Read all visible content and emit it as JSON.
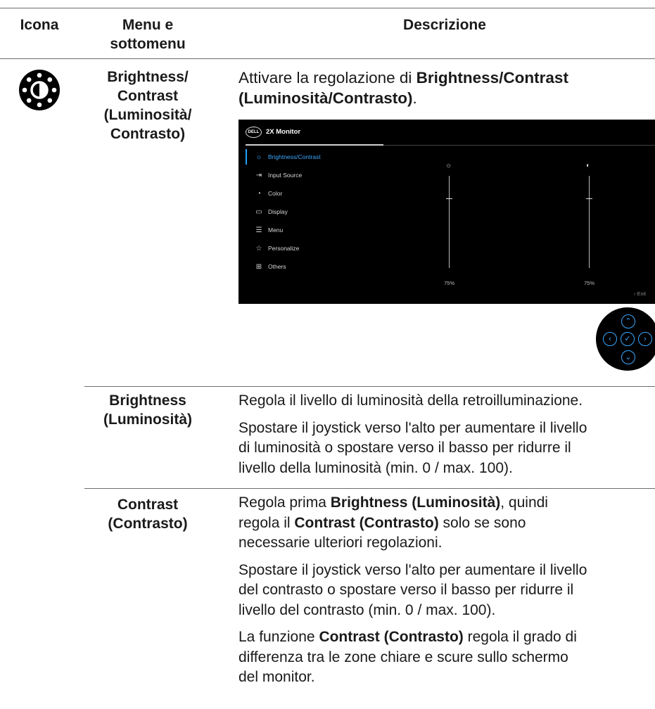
{
  "header": {
    "col_icon": "Icona",
    "col_menu_line1": "Menu e",
    "col_menu_line2": "sottomenu",
    "col_desc": "Descrizione"
  },
  "row_main": {
    "icon": "brightness-contrast-icon",
    "menu_lines": [
      "Brightness/",
      "Contrast",
      "(Luminosità/",
      "Contrasto)"
    ],
    "desc_pre": "Attivare la regolazione di ",
    "desc_bold": "Brightness/Contrast (Luminosità/Contrasto)",
    "desc_post": "."
  },
  "osd": {
    "logo": "DELL",
    "model": "2X Monitor",
    "menu_items": [
      {
        "label": "Brightness/Contrast",
        "icon": "sun-icon",
        "glyph": "☼",
        "selected": true
      },
      {
        "label": "Input Source",
        "icon": "input-icon",
        "glyph": "⇥",
        "selected": false
      },
      {
        "label": "Color",
        "icon": "color-icon",
        "glyph": "◔",
        "selected": false
      },
      {
        "label": "Display",
        "icon": "display-icon",
        "glyph": "▭",
        "selected": false
      },
      {
        "label": "Menu",
        "icon": "menu-icon",
        "glyph": "☰",
        "selected": false
      },
      {
        "label": "Personalize",
        "icon": "star-icon",
        "glyph": "☆",
        "selected": false
      },
      {
        "label": "Others",
        "icon": "others-icon",
        "glyph": "⊞",
        "selected": false
      }
    ],
    "brightness_value": "75%",
    "brightness_level": 0.75,
    "contrast_value": "75%",
    "contrast_level": 0.75,
    "exit_label": "‹ Exit"
  },
  "row_brightness": {
    "menu_lines": [
      "Brightness",
      "(Luminosità)"
    ],
    "p1": "Regola il livello di luminosità della retroilluminazione.",
    "p2_lines": [
      "Spostare il joystick verso l'alto per aumentare il livello",
      "di luminosità o spostare verso il basso per ridurre il",
      "livello della luminosità (min. 0 / max. 100)."
    ]
  },
  "row_contrast": {
    "menu_lines": [
      "Contrast",
      "(Contrasto)"
    ],
    "p1_pre": "Regola prima ",
    "p1_bold1": "Brightness (Luminosità)",
    "p1_mid": ", quindi",
    "p1_line2_pre": "regola il ",
    "p1_bold2": "Contrast (Contrasto)",
    "p1_line2_post": " solo se sono",
    "p1_line3": "necessarie ulteriori regolazioni.",
    "p2_lines": [
      "Spostare il joystick verso l'alto per aumentare il livello",
      "del contrasto o spostare verso il basso per ridurre il",
      "livello del contrasto (min. 0 / max. 100)."
    ],
    "p3_pre": "La funzione ",
    "p3_bold": "Contrast (Contrasto)",
    "p3_post": " regola il grado di",
    "p3_line2": "differenza tra le zone chiare e scure sullo schermo",
    "p3_line3": "del monitor."
  }
}
